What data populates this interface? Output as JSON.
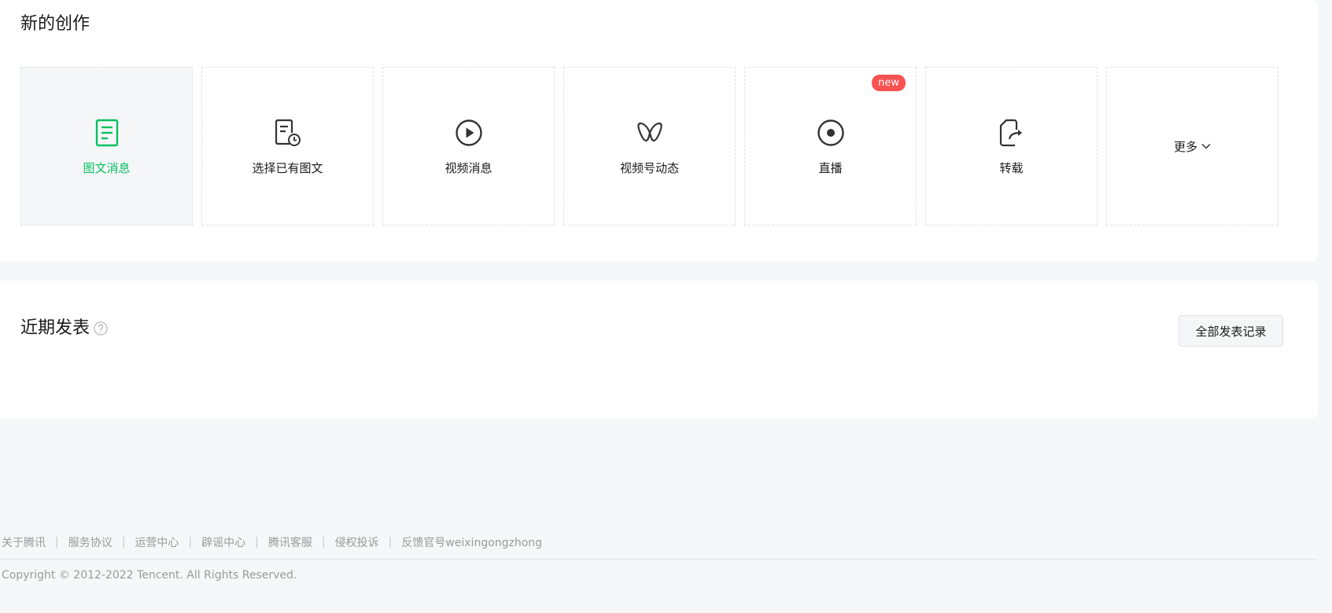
{
  "create": {
    "title": "新的创作",
    "cards": [
      {
        "label": "图文消息",
        "icon": "article-icon"
      },
      {
        "label": "选择已有图文",
        "icon": "existing-article-icon"
      },
      {
        "label": "视频消息",
        "icon": "video-play-icon"
      },
      {
        "label": "视频号动态",
        "icon": "channels-icon"
      },
      {
        "label": "直播",
        "icon": "live-icon",
        "badge": "new"
      },
      {
        "label": "转载",
        "icon": "repost-icon"
      }
    ],
    "more_label": "更多"
  },
  "recent": {
    "title": "近期发表",
    "records_button": "全部发表记录"
  },
  "footer": {
    "links": [
      "关于腾讯",
      "服务协议",
      "运营中心",
      "辟谣中心",
      "腾讯客服",
      "侵权投诉",
      "反馈官号weixingongzhong"
    ],
    "copyright": "Copyright © 2012-2022 Tencent. All Rights Reserved."
  },
  "colors": {
    "accent": "#07c160",
    "badge": "#fa5151",
    "background": "#f6f7f9"
  }
}
